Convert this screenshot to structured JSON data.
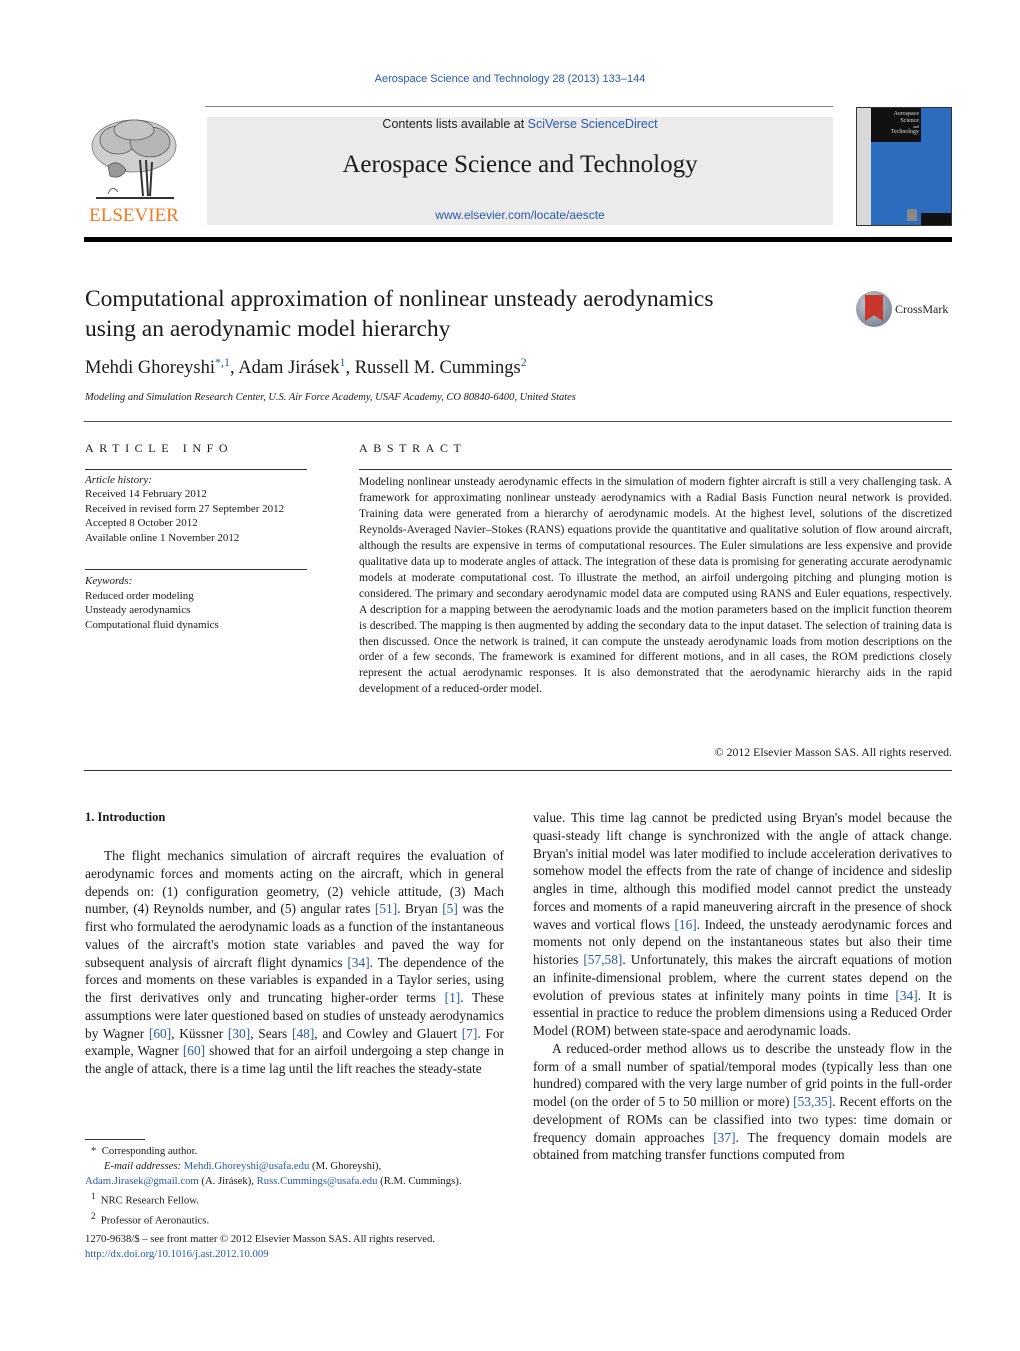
{
  "running_head": "Aerospace Science and Technology 28 (2013) 133–144",
  "masthead": {
    "publisher_logo_text": "ELSEVIER",
    "contents_prefix": "Contents lists available at ",
    "contents_link": "SciVerse ScienceDirect",
    "journal_name": "Aerospace Science and Technology",
    "journal_url": "www.elsevier.com/locate/aescte",
    "cover_title_lines": [
      "Aerospace",
      "Science",
      "and",
      "Technology"
    ]
  },
  "colors": {
    "link": "#2a5aa8",
    "elsevier_orange": "#f47a20",
    "cover_blue": "#2b6cbf",
    "masthead_band": "#ebebeb",
    "crossmark_red": "#c8372b"
  },
  "article": {
    "title_line1": "Computational approximation of nonlinear unsteady aerodynamics",
    "title_line2": "using an aerodynamic model hierarchy",
    "crossmark_label": "CrossMark",
    "authors": [
      {
        "name": "Mehdi Ghoreyshi",
        "marks": "*,1"
      },
      {
        "name": "Adam Jirásek",
        "marks": "1"
      },
      {
        "name": "Russell M. Cummings",
        "marks": "2"
      }
    ],
    "author_separator": ", ",
    "affiliation": "Modeling and Simulation Research Center, U.S. Air Force Academy, USAF Academy, CO 80840-6400, United States"
  },
  "article_info": {
    "heading": "ARTICLE INFO",
    "history_label": "Article history:",
    "history": [
      "Received 14 February 2012",
      "Received in revised form 27 September 2012",
      "Accepted 8 October 2012",
      "Available online 1 November 2012"
    ],
    "keywords_label": "Keywords:",
    "keywords": [
      "Reduced order modeling",
      "Unsteady aerodynamics",
      "Computational fluid dynamics"
    ]
  },
  "abstract": {
    "heading": "ABSTRACT",
    "text": "Modeling nonlinear unsteady aerodynamic effects in the simulation of modern fighter aircraft is still a very challenging task. A framework for approximating nonlinear unsteady aerodynamics with a Radial Basis Function neural network is provided. Training data were generated from a hierarchy of aerodynamic models. At the highest level, solutions of the discretized Reynolds-Averaged Navier–Stokes (RANS) equations provide the quantitative and qualitative solution of flow around aircraft, although the results are expensive in terms of computational resources. The Euler simulations are less expensive and provide qualitative data up to moderate angles of attack. The integration of these data is promising for generating accurate aerodynamic models at moderate computational cost. To illustrate the method, an airfoil undergoing pitching and plunging motion is considered. The primary and secondary aerodynamic model data are computed using RANS and Euler equations, respectively. A description for a mapping between the aerodynamic loads and the motion parameters based on the implicit function theorem is described. The mapping is then augmented by adding the secondary data to the input dataset. The selection of training data is then discussed. Once the network is trained, it can compute the unsteady aerodynamic loads from motion descriptions on the order of a few seconds. The framework is examined for different motions, and in all cases, the ROM predictions closely represent the actual aerodynamic responses. It is also demonstrated that the aerodynamic hierarchy aids in the rapid development of a reduced-order model.",
    "copyright": "© 2012 Elsevier Masson SAS. All rights reserved."
  },
  "intro": {
    "heading": "1. Introduction",
    "left_paragraph": [
      {
        "t": "The flight mechanics simulation of aircraft requires the evaluation of aerodynamic forces and moments acting on the aircraft, which in general depends on: (1) configuration geometry, (2) vehicle attitude, (3) Mach number, (4) Reynolds number, and (5) angular rates "
      },
      {
        "c": "[51]"
      },
      {
        "t": ". Bryan "
      },
      {
        "c": "[5]"
      },
      {
        "t": " was the first who formulated the aerodynamic loads as a function of the instantaneous values of the aircraft's motion state variables and paved the way for subsequent analysis of aircraft flight dynamics "
      },
      {
        "c": "[34]"
      },
      {
        "t": ". The dependence of the forces and moments on these variables is expanded in a Taylor series, using the first derivatives only and truncating higher-order terms "
      },
      {
        "c": "[1]"
      },
      {
        "t": ". These assumptions were later questioned based on studies of unsteady aerodynamics by Wagner "
      },
      {
        "c": "[60]"
      },
      {
        "t": ", Küssner "
      },
      {
        "c": "[30]"
      },
      {
        "t": ", Sears "
      },
      {
        "c": "[48]"
      },
      {
        "t": ", and Cowley and Glauert "
      },
      {
        "c": "[7]"
      },
      {
        "t": ". For example, Wagner "
      },
      {
        "c": "[60]"
      },
      {
        "t": " showed that for an airfoil undergoing a step change in the angle of attack, there is a time lag until the lift reaches the steady-state"
      }
    ],
    "right_paragraph_1": [
      {
        "t": "value. This time lag cannot be predicted using Bryan's model because the quasi-steady lift change is synchronized with the angle of attack change. Bryan's initial model was later modified to include acceleration derivatives to somehow model the effects from the rate of change of incidence and sideslip angles in time, although this modified model cannot predict the unsteady forces and moments of a rapid maneuvering aircraft in the presence of shock waves and vortical flows "
      },
      {
        "c": "[16]"
      },
      {
        "t": ". Indeed, the unsteady aerodynamic forces and moments not only depend on the instantaneous states but also their time histories "
      },
      {
        "c": "[57,58]"
      },
      {
        "t": ". Unfortunately, this makes the aircraft equations of motion an infinite-dimensional problem, where the current states depend on the evolution of previous states at infinitely many points in time "
      },
      {
        "c": "[34]"
      },
      {
        "t": ". It is essential in practice to reduce the problem dimensions using a Reduced Order Model (ROM) between state-space and aerodynamic loads."
      }
    ],
    "right_paragraph_2": [
      {
        "t": "A reduced-order method allows us to describe the unsteady flow in the form of a small number of spatial/temporal modes (typically less than one hundred) compared with the very large number of grid points in the full-order model (on the order of 5 to 50 million or more) "
      },
      {
        "c": "[53,35]"
      },
      {
        "t": ". Recent efforts on the development of ROMs can be classified into two types: time domain or frequency domain approaches "
      },
      {
        "c": "[37]"
      },
      {
        "t": ". The frequency domain models are obtained from matching transfer functions computed from"
      }
    ]
  },
  "footnotes": {
    "star_mark": "*",
    "corresponding": "Corresponding author.",
    "email_label": "E-mail addresses:",
    "emails": [
      {
        "address": "Mehdi.Ghoreyshi@usafa.edu",
        "who": " (M. Ghoreyshi),"
      },
      {
        "address": "Adam.Jirasek@gmail.com",
        "who": " (A. Jirásek), "
      },
      {
        "address": "Russ.Cummings@usafa.edu",
        "who": " (R.M. Cummings)."
      }
    ],
    "note1_mark": "1",
    "note1": "NRC Research Fellow.",
    "note2_mark": "2",
    "note2": "Professor of Aeronautics."
  },
  "front_matter": {
    "issn_line": "1270-9638/$ – see front matter  © 2012 Elsevier Masson SAS. All rights reserved.",
    "doi": "http://dx.doi.org/10.1016/j.ast.2012.10.009"
  }
}
